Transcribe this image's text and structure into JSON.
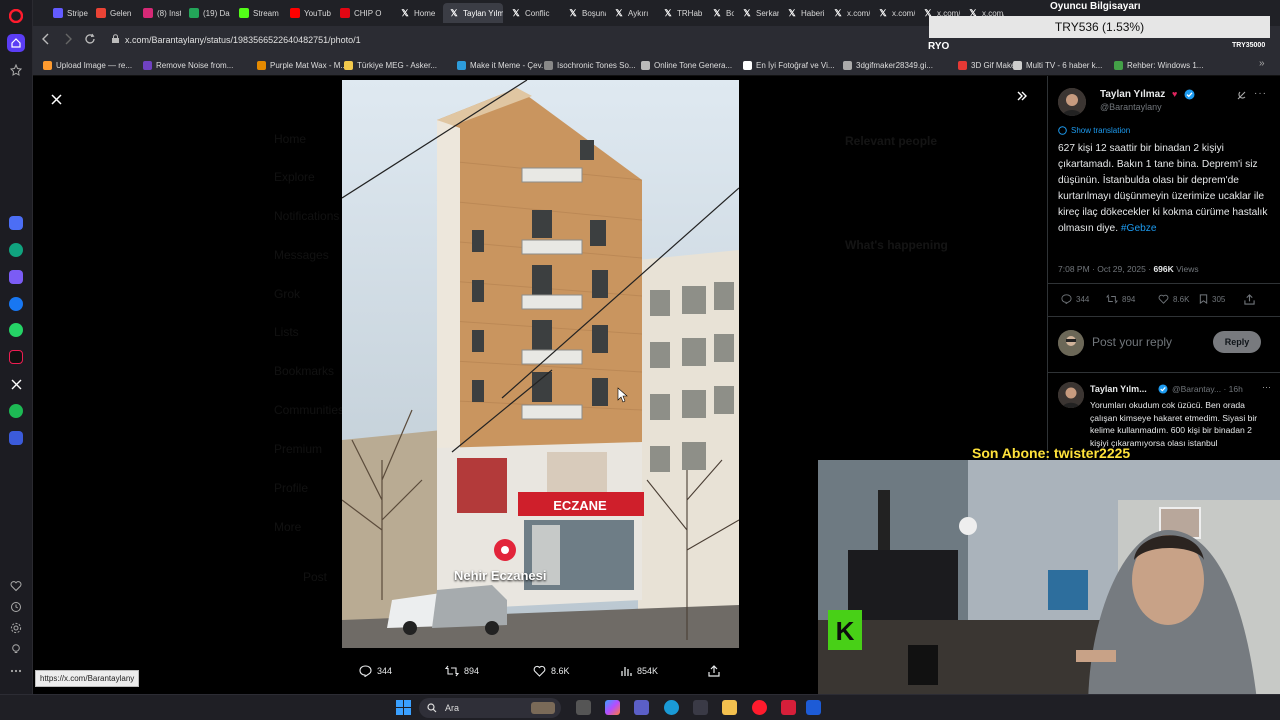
{
  "browser": {
    "tabs": [
      {
        "label": "Stripe",
        "icon": "stripe-icon",
        "color": "#635bff"
      },
      {
        "label": "Gelen",
        "icon": "gmail-icon",
        "color": "#ea4335"
      },
      {
        "label": "(8) Inst",
        "icon": "instagram-icon",
        "color": "#d62976"
      },
      {
        "label": "(19) Da",
        "icon": "dashboard-icon",
        "color": "#23a559"
      },
      {
        "label": "Stream",
        "icon": "kick-icon",
        "color": "#53fc18"
      },
      {
        "label": "YouTub",
        "icon": "youtube-icon",
        "color": "#ff0000"
      },
      {
        "label": "CHIP O",
        "icon": "chip-icon",
        "color": "#e30613"
      },
      {
        "label": "Home",
        "icon": "x-icon",
        "color": "#ffffff"
      },
      {
        "label": "Taylan Yılma",
        "icon": "x-icon",
        "color": "#ffffff",
        "active": true
      },
      {
        "label": "Conflic",
        "icon": "x-icon",
        "color": "#ffffff"
      },
      {
        "label": "Boşuna",
        "icon": "x-icon",
        "color": "#ffffff"
      },
      {
        "label": "Aykırı",
        "icon": "x-icon",
        "color": "#ffffff"
      },
      {
        "label": "TRHab",
        "icon": "x-icon",
        "color": "#ffffff"
      },
      {
        "label": "Boşuna",
        "icon": "x-icon",
        "color": "#ffffff"
      },
      {
        "label": "Serkan",
        "icon": "x-icon",
        "color": "#ffffff"
      },
      {
        "label": "Haberi",
        "icon": "x-icon",
        "color": "#ffffff"
      },
      {
        "label": "x.com/",
        "icon": "x-icon",
        "color": "#ffffff"
      },
      {
        "label": "x.com/",
        "icon": "x-icon",
        "color": "#ffffff"
      },
      {
        "label": "x.com/",
        "icon": "x-icon",
        "color": "#ffffff"
      },
      {
        "label": "x.com/",
        "icon": "x-icon",
        "color": "#ffffff"
      }
    ],
    "url": "x.com/Barantaylany/status/1983566522640482751/photo/1",
    "bookmarks": [
      {
        "label": "Upload Image — re...",
        "color": "#ff9b2f"
      },
      {
        "label": "Remove Noise from...",
        "color": "#6f42c1"
      },
      {
        "label": "Purple Mat Wax - M...",
        "color": "#e58a00"
      },
      {
        "label": "Türkiye MEG - Asker...",
        "color": "#f2c94c"
      },
      {
        "label": "Make it Meme - Çev...",
        "color": "#2d9cdb"
      },
      {
        "label": "Isochronic Tones So...",
        "color": "#888888"
      },
      {
        "label": "Online Tone Genera...",
        "color": "#bbbbbb"
      },
      {
        "label": "En İyi Fotoğraf ve Vi...",
        "color": "#ffffff"
      },
      {
        "label": "3dgifmaker28349.gi...",
        "color": "#aaaaaa"
      },
      {
        "label": "3D Gif Maker",
        "color": "#e53935"
      },
      {
        "label": "Multi TV - 6 haber k...",
        "color": "#cccccc"
      },
      {
        "label": "Rehber: Windows 1...",
        "color": "#43a047"
      }
    ],
    "status_url": "https://x.com/Barantaylany"
  },
  "viewer": {
    "photo_caption": "Nehir Eczanesi",
    "pharmacy_sign": "ECZANE",
    "actions": {
      "replies": "344",
      "reposts": "894",
      "likes": "8.6K",
      "views": "854K"
    }
  },
  "background_ghost": {
    "nav": [
      "Home",
      "Explore",
      "Notifications",
      "Messages",
      "Grok",
      "Lists",
      "Bookmarks",
      "Communities",
      "Premium",
      "Profile",
      "More"
    ],
    "post_button": "Post",
    "relevant_people": "Relevant people",
    "whats_happening": "What's happening"
  },
  "post": {
    "author_name": "Taylan Yılmaz",
    "author_handle": "@Barantaylany",
    "show_translation": "Show translation",
    "text": "627 kişi 12 saattir bir binadan 2 kişiyi çıkartamadı. Bakın 1 tane bina. Deprem'i siz düşünün. İstanbulda olası bir deprem'de kurtarılmayı düşünmeyin üzerimize ucaklar ile kireç ilaç dökecekler ki kokma cürüme hastalık olmasın diye.",
    "hashtag": "#Gebze",
    "time": "7:08 PM · Oct 29, 2025 ·",
    "views_count": "696K",
    "views_label": "Views",
    "stats": {
      "replies": "344",
      "reposts": "894",
      "likes": "8.6K",
      "bookmarks": "305"
    },
    "reply_placeholder": "Post your reply",
    "reply_button": "Reply"
  },
  "reply": {
    "author_name": "Taylan Yılm...",
    "author_handle": "@Barantay...",
    "time": "· 16h",
    "text": "Yorumları okudum cok üzücü. Ben orada çalışan kimseye hakaret etmedim. Siyasi bir kelime kullanmadım. 600 kişi bir binadan 2 kişiyi çıkaramıyorsa olası istanbul"
  },
  "stream_overlay": {
    "streamer_label": "Oyuncu Bilgisayarı",
    "ticker": "TRY536 (1.53%)",
    "ryo_label": "RYO",
    "try_small": "TRY35000",
    "last_sub": "Son Abone: twister2225"
  },
  "taskbar": {
    "search_label": "Ara"
  },
  "colors": {
    "accent": "#1d9bf0",
    "x_bg": "#000000",
    "sub_label": "#ffe23b"
  }
}
